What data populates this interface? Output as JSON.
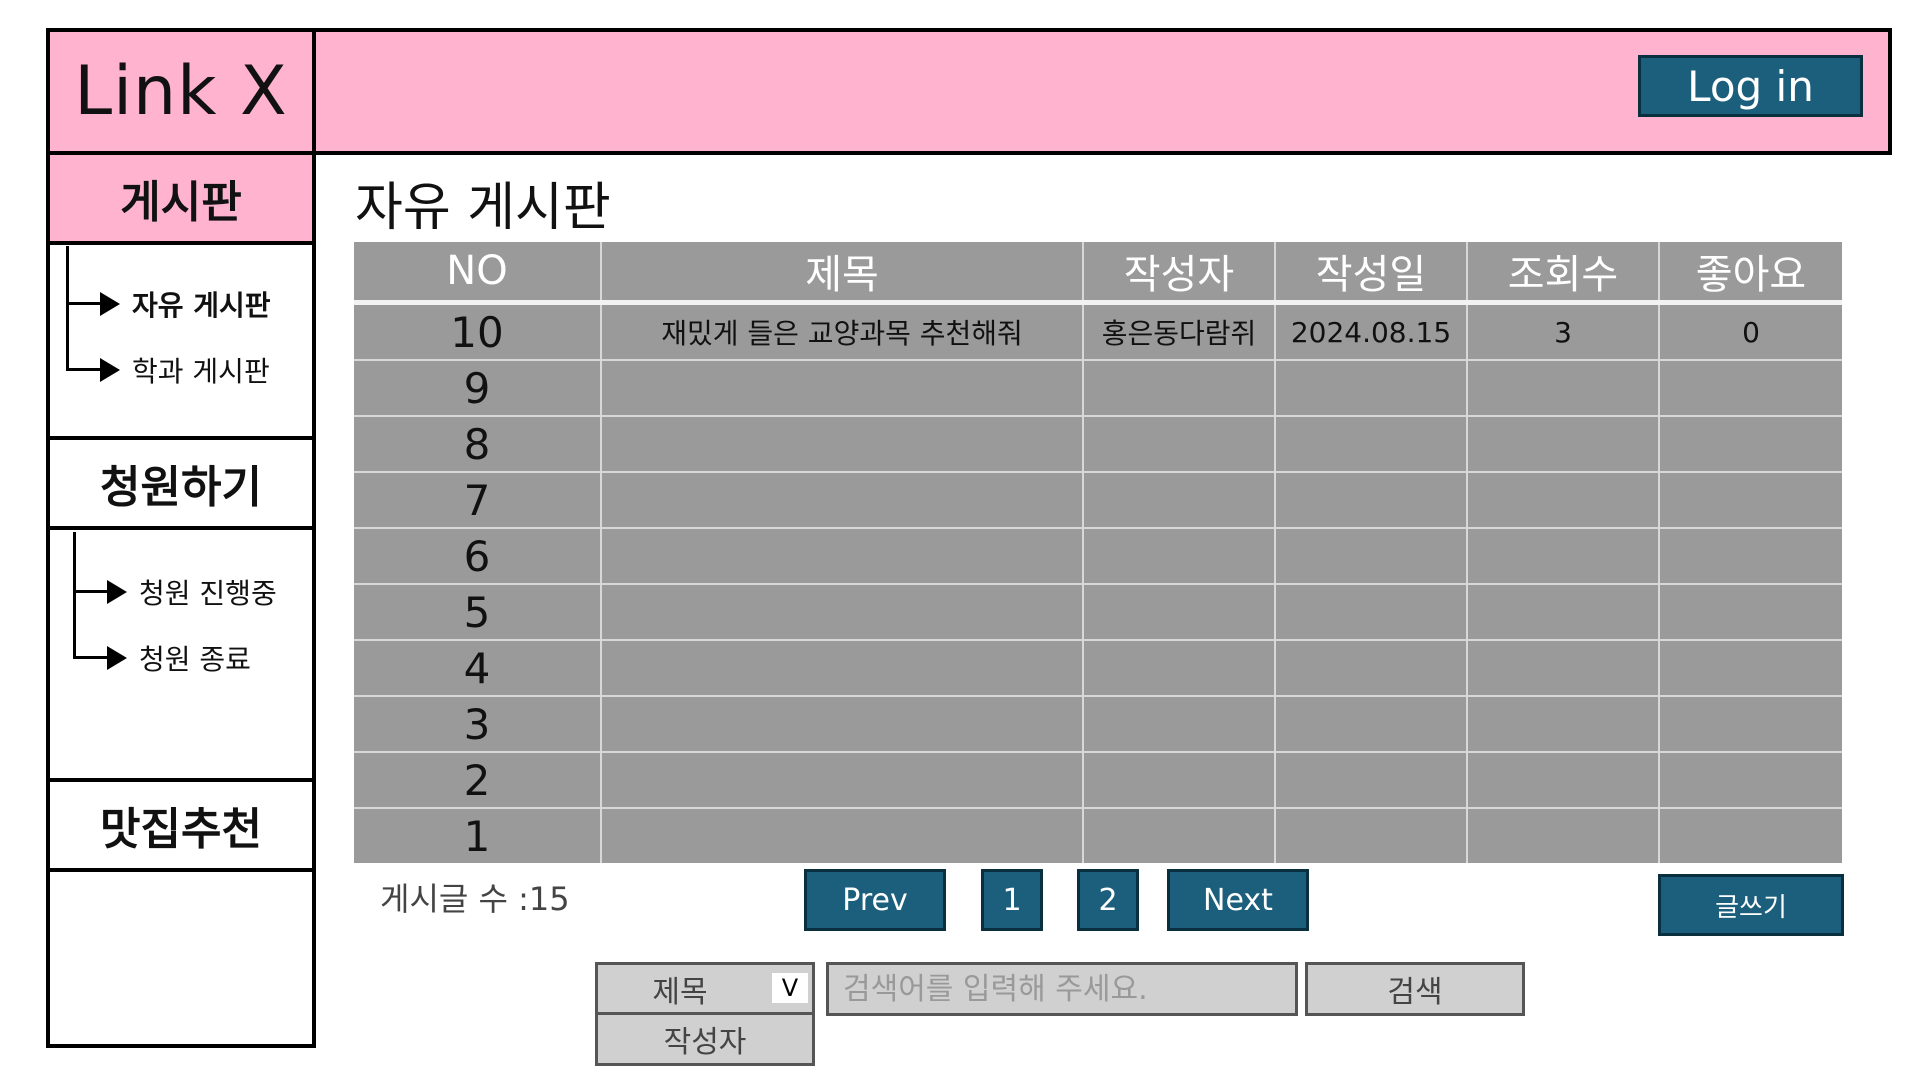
{
  "header": {
    "logo": "Link X",
    "login_label": "Log in"
  },
  "sidebar": {
    "categories": [
      {
        "label": "게시판",
        "active": true,
        "items": [
          {
            "label": "자유 게시판",
            "active": true
          },
          {
            "label": "학과 게시판",
            "active": false
          }
        ]
      },
      {
        "label": "청원하기",
        "active": false,
        "items": [
          {
            "label": "청원 진행중",
            "active": false
          },
          {
            "label": "청원 종료",
            "active": false
          }
        ]
      },
      {
        "label": "맛집추천",
        "active": false,
        "items": []
      }
    ]
  },
  "main": {
    "page_title": "자유 게시판",
    "table": {
      "columns": [
        "NO",
        "제목",
        "작성자",
        "작성일",
        "조회수",
        "좋아요"
      ],
      "rows": [
        {
          "no": "10",
          "title": "재밌게 들은 교양과목 추천해줘",
          "author": "홍은동다람쥐",
          "date": "2024.08.15",
          "views": "3",
          "likes": "0"
        },
        {
          "no": "9",
          "title": "",
          "author": "",
          "date": "",
          "views": "",
          "likes": ""
        },
        {
          "no": "8",
          "title": "",
          "author": "",
          "date": "",
          "views": "",
          "likes": ""
        },
        {
          "no": "7",
          "title": "",
          "author": "",
          "date": "",
          "views": "",
          "likes": ""
        },
        {
          "no": "6",
          "title": "",
          "author": "",
          "date": "",
          "views": "",
          "likes": ""
        },
        {
          "no": "5",
          "title": "",
          "author": "",
          "date": "",
          "views": "",
          "likes": ""
        },
        {
          "no": "4",
          "title": "",
          "author": "",
          "date": "",
          "views": "",
          "likes": ""
        },
        {
          "no": "3",
          "title": "",
          "author": "",
          "date": "",
          "views": "",
          "likes": ""
        },
        {
          "no": "2",
          "title": "",
          "author": "",
          "date": "",
          "views": "",
          "likes": ""
        },
        {
          "no": "1",
          "title": "",
          "author": "",
          "date": "",
          "views": "",
          "likes": ""
        }
      ]
    },
    "post_count": "게시글 수 :15",
    "pagination": {
      "prev_label": "Prev",
      "pages": [
        "1",
        "2"
      ],
      "next_label": "Next"
    },
    "write_label": "글쓰기",
    "search": {
      "selected_option": "제목",
      "options": [
        "제목",
        "작성자"
      ],
      "dropdown_glyph": "V",
      "placeholder": "검색어를 입력해 주세요.",
      "button_label": "검색"
    }
  },
  "colors": {
    "header_pink": "#ffb3cf",
    "button_blue": "#1b5f7d",
    "table_gray": "#9a9a9a",
    "search_gray": "#d0d0d0"
  }
}
